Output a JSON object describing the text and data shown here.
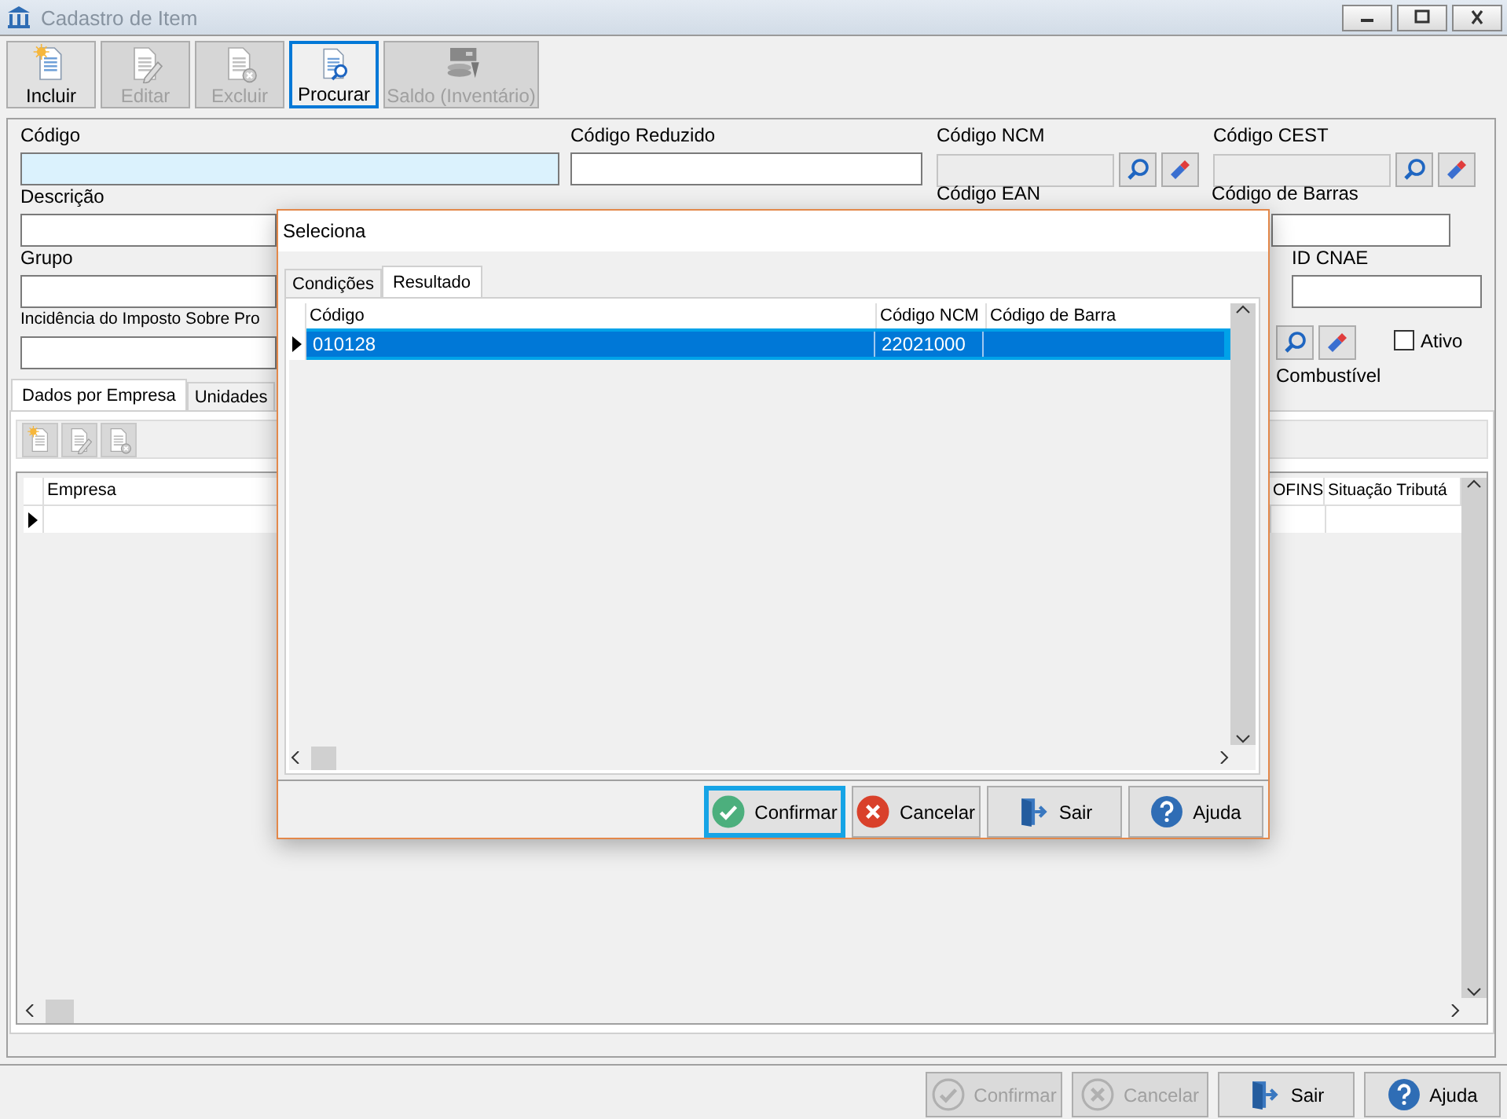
{
  "window": {
    "title": "Cadastro de Item"
  },
  "toolbar": [
    {
      "label": "Incluir",
      "kind": "new",
      "disabled": false,
      "focused": false
    },
    {
      "label": "Editar",
      "kind": "edit",
      "disabled": true,
      "focused": false
    },
    {
      "label": "Excluir",
      "kind": "delete",
      "disabled": true,
      "focused": false
    },
    {
      "label": "Procurar",
      "kind": "search",
      "disabled": false,
      "focused": true
    },
    {
      "label": "Saldo (Inventário)",
      "kind": "stock",
      "disabled": true,
      "focused": false
    }
  ],
  "form": {
    "codigo": {
      "label": "Código",
      "focused": true,
      "disabled": false
    },
    "codigo_reduzido": {
      "label": "Código Reduzido",
      "focused": false,
      "disabled": false
    },
    "codigo_ncm": {
      "label": "Código NCM",
      "focused": false,
      "disabled": true
    },
    "codigo_cest": {
      "label": "Código CEST",
      "focused": false,
      "disabled": true
    },
    "descricao": {
      "label": "Descrição",
      "focused": false,
      "disabled": false
    },
    "codigo_ean": {
      "label": "Código EAN"
    },
    "codigo_barras": {
      "label": "Código de Barras",
      "focused": false,
      "disabled": false
    },
    "grupo": {
      "label": "Grupo",
      "focused": false,
      "disabled": false
    },
    "id_cnae": {
      "label": "ID CNAE",
      "focused": false,
      "disabled": false
    },
    "incidencia": {
      "label": "Incidência do Imposto Sobre Pro",
      "focused": false,
      "disabled": false
    },
    "ativo": {
      "label": "Ativo",
      "checked": false
    },
    "combustivel": {
      "label": "Combustível"
    }
  },
  "tabs": [
    {
      "label": "Dados por Empresa",
      "selected": true
    },
    {
      "label": "Unidades",
      "selected": false
    }
  ],
  "grid": {
    "columns": [
      "Empresa",
      "OFINS",
      "Situação Tributá"
    ]
  },
  "dialog": {
    "title": "Seleciona",
    "tabs": [
      {
        "label": "Condições",
        "selected": false
      },
      {
        "label": "Resultado",
        "selected": true
      }
    ],
    "columns": [
      "Código",
      "Código NCM",
      "Código de Barra"
    ],
    "rows": [
      {
        "cells": [
          "010128",
          "22021000"
        ],
        "selected": true
      }
    ],
    "buttons": [
      {
        "label": "Confirmar",
        "kind": "confirm",
        "focused": true
      },
      {
        "label": "Cancelar",
        "kind": "cancel",
        "focused": false
      },
      {
        "label": "Sair",
        "kind": "exit",
        "focused": false
      },
      {
        "label": "Ajuda",
        "kind": "help",
        "focused": false
      }
    ]
  },
  "buttons": [
    {
      "label": "Confirmar",
      "kind": "confirm",
      "disabled": true
    },
    {
      "label": "Cancelar",
      "kind": "cancel",
      "disabled": true
    },
    {
      "label": "Sair",
      "kind": "exit",
      "disabled": false
    },
    {
      "label": "Ajuda",
      "kind": "help",
      "disabled": false
    }
  ]
}
